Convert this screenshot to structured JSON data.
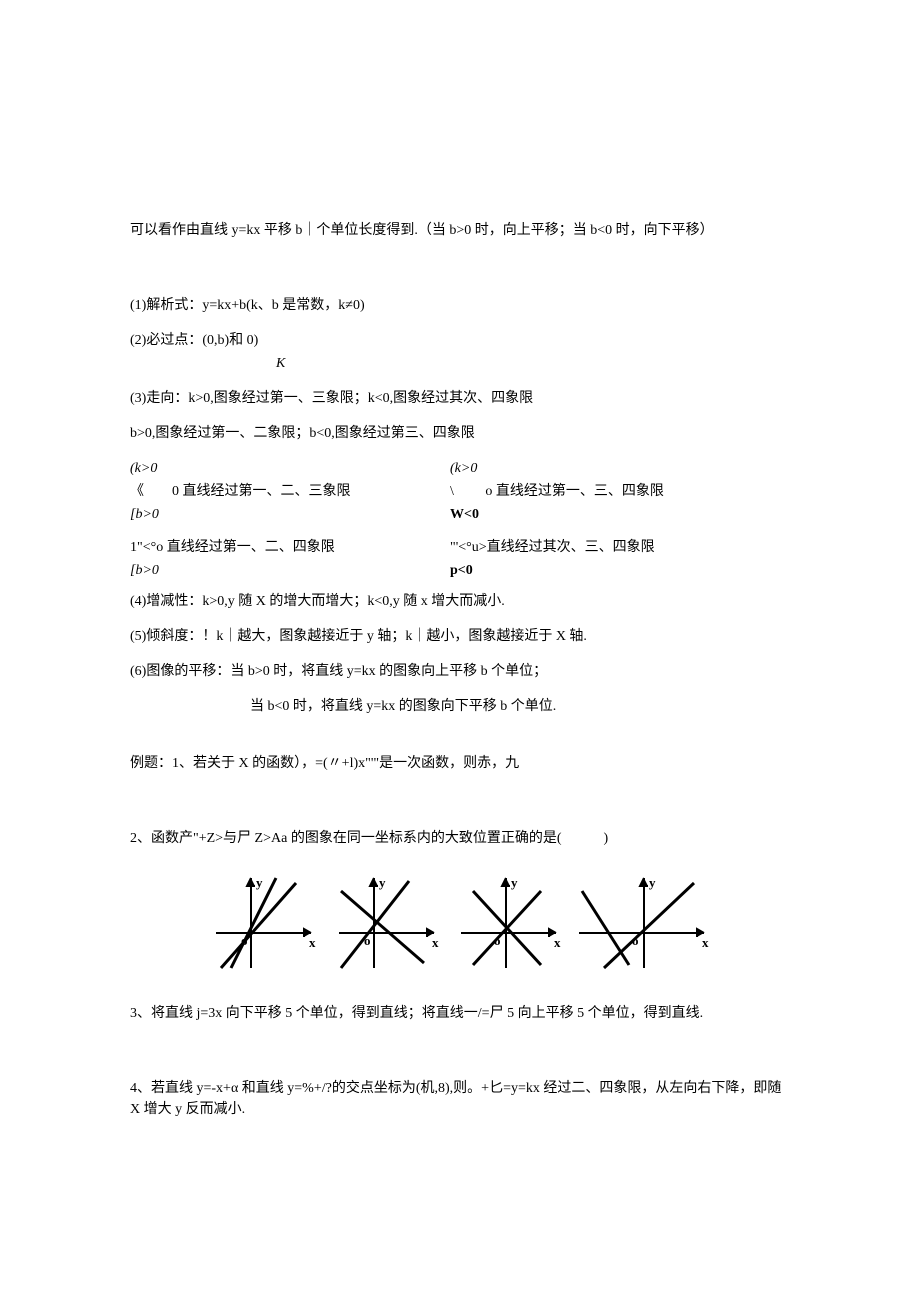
{
  "intro": "可以看作由直线 y=kx 平移 b｜个单位长度得到.（当 b>0 时，向上平移；当 b<0 时，向下平移）",
  "item1": "(1)解析式：y=kx+b(k、b 是常数，k≠0)",
  "item2_line": "(2)必过点：(0,b)和 0)",
  "item2_k": "K",
  "item3_a": "(3)走向：k>0,图象经过第一、三象限；k<0,图象经过其次、四象限",
  "item3_b": "b>0,图象经过第一、二象限；b<0,图象经过第三、四象限",
  "case1": {
    "top_l": "(k>0",
    "mid_l": " 《　　0 直线经过第一、二、三象限",
    "bot_l": "[b>0",
    "top_r": "(k>0",
    "mid_r": " \\　　 o 直线经过第一、三、四象限",
    "bot_r": "W<0"
  },
  "case2": {
    "top_l": "1\"<°o 直线经过第一、二、四象限",
    "bot_l": "[b>0",
    "top_r": "\"'<°u>直线经过其次、三、四象限",
    "bot_r": "p<0"
  },
  "item4": "(4)增减性：k>0,y 随 X 的增大而增大；k<0,y 随 x 增大而减小.",
  "item5": "(5)倾斜度：！k｜越大，图象越接近于 y 轴；k｜越小，图象越接近于 X 轴.",
  "item6a": "(6)图像的平移：当 b>0 时，将直线 y=kx 的图象向上平移 b 个单位；",
  "item6b": "当 b<0 时，将直线 y=kx 的图象向下平移 b 个单位.",
  "ex1": "例题：1、若关于 X 的函数），=(〃+l)x\"'\"是一次函数，则赤，九",
  "ex2": "2、函数产\"+Z>与尸 Z>Aa 的图象在同一坐标系内的大致位置正确的是(　　　)",
  "ex3": "3、将直线 j=3x 向下平移 5 个单位，得到直线；将直线一/=尸 5 向上平移 5 个单位，得到直线.",
  "ex4": "4、若直线 y=-x+α 和直线 y=%+/?的交点坐标为(机,8),则。+匕=y=kx 经过二、四象限，从左向右下降，即随 X 增大 y 反而减小.",
  "chart": {
    "labels": {
      "x": "x",
      "y": "y",
      "o": "o"
    }
  }
}
